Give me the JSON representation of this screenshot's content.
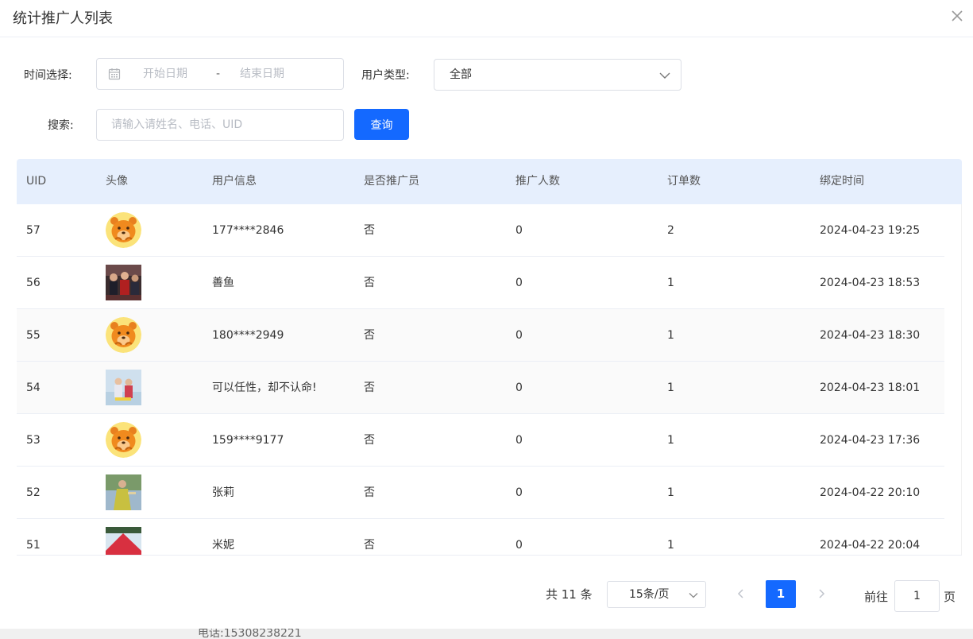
{
  "dialog": {
    "title": "统计推广人列表"
  },
  "filters": {
    "time_label": "时间选择:",
    "start_placeholder": "开始日期",
    "separator": "-",
    "end_placeholder": "结束日期",
    "user_type_label": "用户类型:",
    "user_type_value": "全部",
    "search_label": "搜索:",
    "search_placeholder": "请输入请姓名、电话、UID",
    "query_button": "查询"
  },
  "table": {
    "headers": [
      "UID",
      "头像",
      "用户信息",
      "是否推广员",
      "推广人数",
      "订单数",
      "绑定时间"
    ],
    "rows": [
      {
        "uid": "57",
        "avatar": "orange-bear",
        "user": "177****2846",
        "promoter": "否",
        "promoted": "0",
        "orders": "2",
        "bound": "2024-04-23 19:25"
      },
      {
        "uid": "56",
        "avatar": "photo-crowd",
        "user": "善鱼",
        "promoter": "否",
        "promoted": "0",
        "orders": "1",
        "bound": "2024-04-23 18:53"
      },
      {
        "uid": "55",
        "avatar": "orange-bear",
        "user": "180****2949",
        "promoter": "否",
        "promoted": "0",
        "orders": "1",
        "bound": "2024-04-23 18:30"
      },
      {
        "uid": "54",
        "avatar": "photo-couple",
        "user": "可以任性，却不认命!",
        "promoter": "否",
        "promoted": "0",
        "orders": "1",
        "bound": "2024-04-23 18:01"
      },
      {
        "uid": "53",
        "avatar": "orange-bear",
        "user": "159****9177",
        "promoter": "否",
        "promoted": "0",
        "orders": "1",
        "bound": "2024-04-23 17:36"
      },
      {
        "uid": "52",
        "avatar": "photo-portrait",
        "user": "张莉",
        "promoter": "否",
        "promoted": "0",
        "orders": "1",
        "bound": "2024-04-22 20:10"
      },
      {
        "uid": "51",
        "avatar": "photo-landscape",
        "user": "米妮",
        "promoter": "否",
        "promoted": "0",
        "orders": "1",
        "bound": "2024-04-22 20:04"
      }
    ]
  },
  "pagination": {
    "total": "共 11 条",
    "page_size": "15条/页",
    "current_page": "1",
    "goto_label": "前往",
    "goto_value": "1",
    "goto_unit": "页"
  },
  "background_text": "电话:15308238221",
  "colors": {
    "primary": "#1469ff",
    "header_bg": "#e6effd"
  }
}
